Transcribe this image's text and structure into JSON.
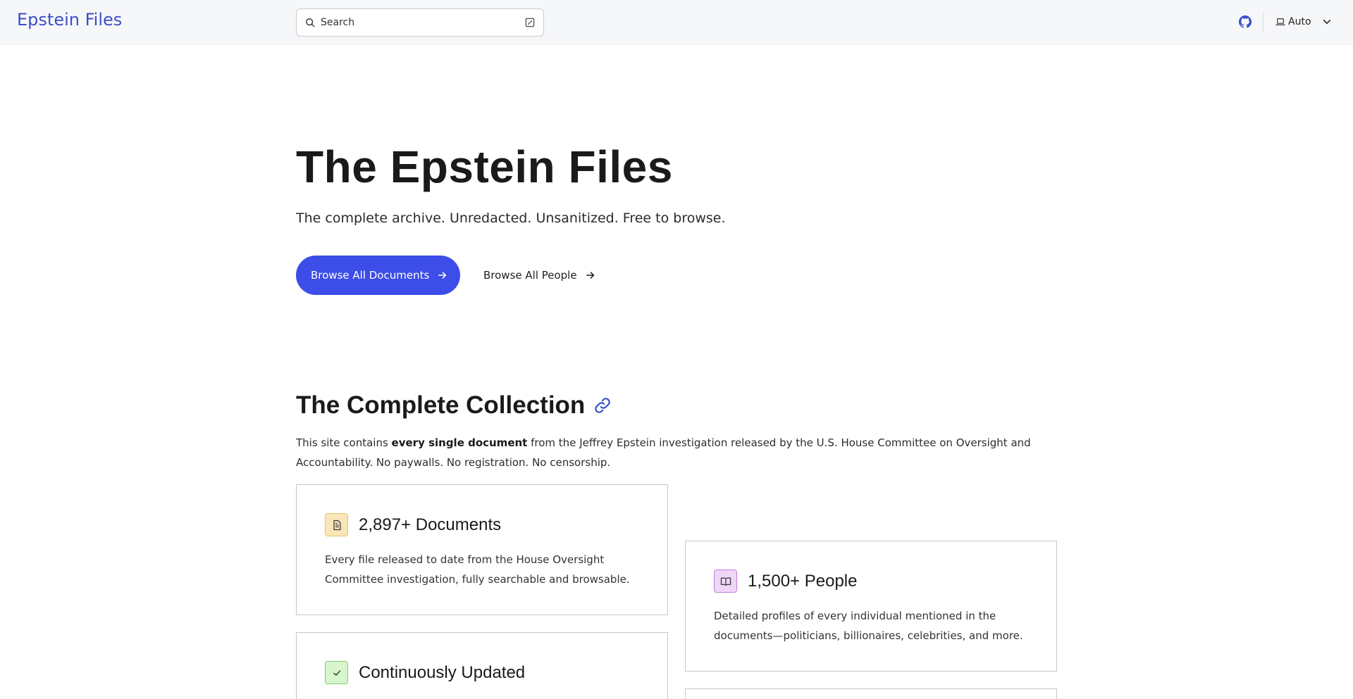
{
  "header": {
    "brand": "Epstein Files",
    "search_placeholder": "Search",
    "theme_label": "Auto",
    "icons": [
      "search-icon",
      "keyboard-shortcut-icon",
      "github-icon",
      "laptop-icon",
      "chevron-down-icon"
    ]
  },
  "hero": {
    "title": "The Epstein Files",
    "subtitle": "The complete archive. Unredacted. Unsanitized. Free to browse.",
    "primary_button": "Browse All Documents",
    "secondary_button": "Browse All People"
  },
  "collection": {
    "title": "The Complete Collection",
    "desc_pre": "This site contains ",
    "desc_bold": "every single document",
    "desc_post": " from the Jeffrey Epstein investigation released by the U.S. House Committee on Oversight and Accountability. No paywalls. No registration. No censorship.",
    "cards": [
      {
        "title": "2,897+ Documents",
        "desc": "Every file released to date from the House Oversight Committee investigation, fully searchable and browsable.",
        "icon": "document-icon"
      },
      {
        "title": "1,500+ People",
        "desc": "Detailed profiles of every individual mentioned in the documents—politicians, billionaires, celebrities, and more.",
        "icon": "book-icon"
      },
      {
        "title": "Continuously Updated",
        "desc": "",
        "icon": "check-icon"
      }
    ]
  },
  "colors": {
    "brand": "#3a4fc8",
    "primary_button": "#3c4de8",
    "header_bg": "#f6f7f9"
  }
}
